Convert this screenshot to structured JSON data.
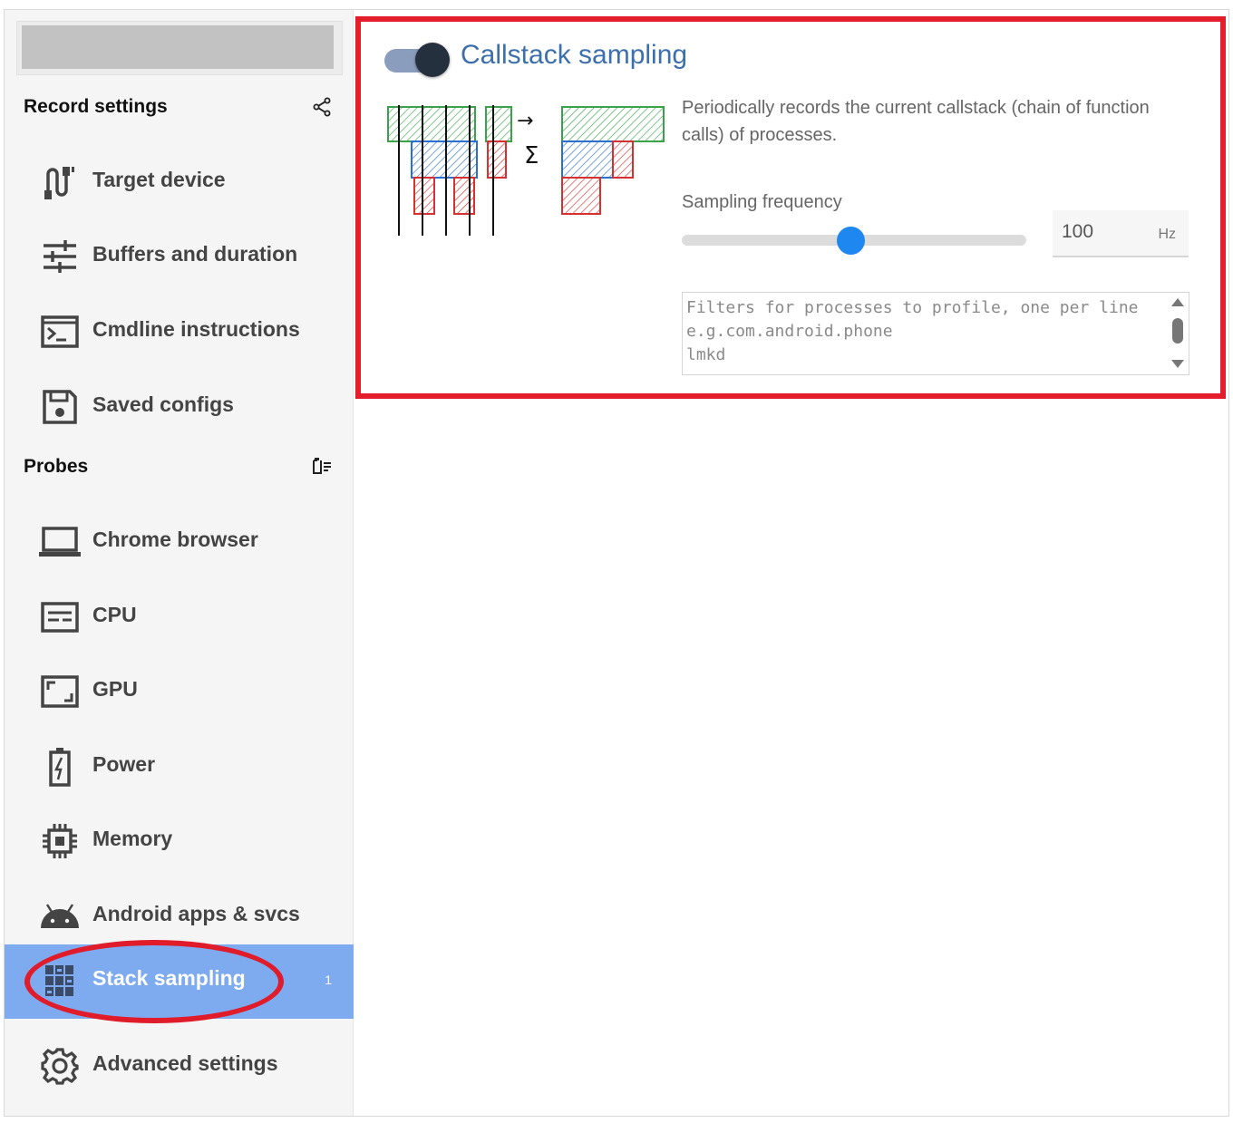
{
  "sidebar": {
    "record_settings": {
      "title": "Record settings",
      "share_icon": "share-icon"
    },
    "record_items": [
      {
        "label": "Target device",
        "icon": "usb-cable-icon"
      },
      {
        "label": "Buffers and duration",
        "icon": "sliders-icon"
      },
      {
        "label": "Cmdline instructions",
        "icon": "terminal-icon"
      },
      {
        "label": "Saved configs",
        "icon": "save-icon"
      }
    ],
    "probes": {
      "title": "Probes",
      "clear_icon": "clear-all-icon"
    },
    "probe_items": [
      {
        "label": "Chrome browser",
        "icon": "laptop-icon"
      },
      {
        "label": "CPU",
        "icon": "cpu-icon"
      },
      {
        "label": "GPU",
        "icon": "gpu-icon"
      },
      {
        "label": "Power",
        "icon": "battery-charging-icon"
      },
      {
        "label": "Memory",
        "icon": "memory-chip-icon"
      },
      {
        "label": "Android apps & svcs",
        "icon": "android-icon"
      },
      {
        "label": "Stack sampling",
        "icon": "stack-icon",
        "count": "1",
        "active": true
      },
      {
        "label": "Advanced settings",
        "icon": "settings-gear-icon"
      }
    ]
  },
  "card": {
    "title": "Callstack sampling",
    "toggle_on": true,
    "description": "Periodically records the current callstack (chain of function calls) of processes.",
    "sampling_frequency": {
      "label": "Sampling frequency",
      "value": "100",
      "unit": "Hz",
      "slider_fraction": 0.49
    },
    "filters": {
      "text": "Filters for processes to profile, one per line e.g.com.android.phone\nlmkd"
    },
    "diagram_symbols": {
      "arrow": "→",
      "sigma": "Σ"
    }
  },
  "colors": {
    "accent": "#3d6fad",
    "active_item": "#7eaaf0",
    "annotation_red": "#e31d2b",
    "slider_thumb": "#1f87f0",
    "green": "#3aa34a",
    "blue": "#2a70d0",
    "red": "#d63030"
  }
}
